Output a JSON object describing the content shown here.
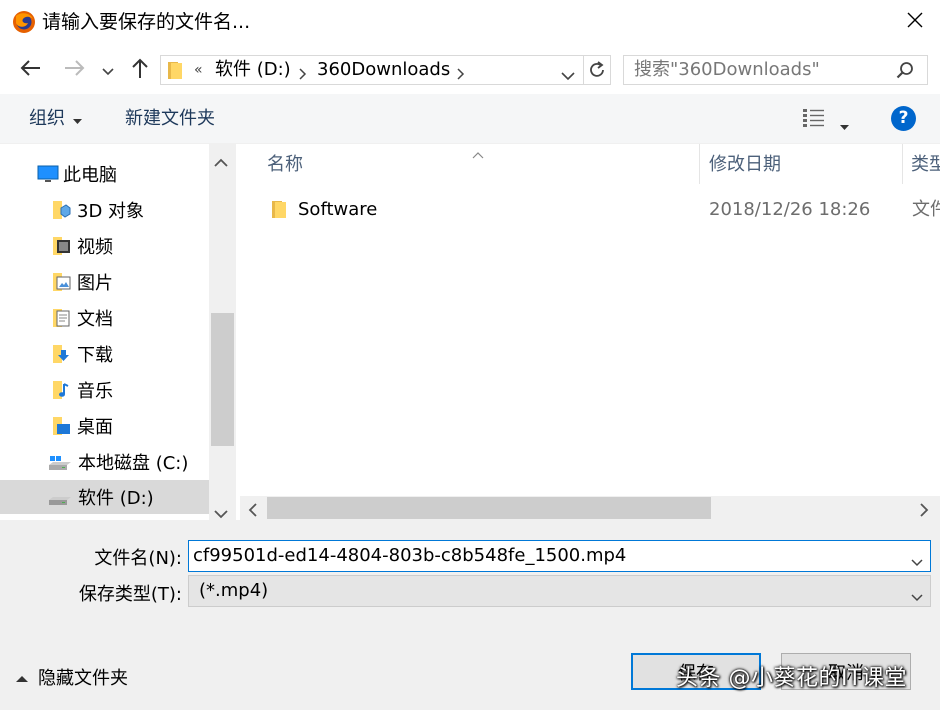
{
  "window": {
    "title": "请输入要保存的文件名...",
    "close_symbol": "✕"
  },
  "address": {
    "overflow": "«",
    "breadcrumbs": [
      "软件 (D:)",
      "360Downloads"
    ],
    "search_placeholder": "搜索\"360Downloads\""
  },
  "toolbar": {
    "organize_label": "组织",
    "new_folder_label": "新建文件夹",
    "help_label": "?"
  },
  "nav": {
    "items": [
      {
        "label": "此电脑",
        "icon": "this-pc-icon"
      },
      {
        "label": "3D 对象",
        "icon": "3d-objects-icon"
      },
      {
        "label": "视频",
        "icon": "videos-icon"
      },
      {
        "label": "图片",
        "icon": "pictures-icon"
      },
      {
        "label": "文档",
        "icon": "documents-icon"
      },
      {
        "label": "下载",
        "icon": "downloads-icon"
      },
      {
        "label": "音乐",
        "icon": "music-icon"
      },
      {
        "label": "桌面",
        "icon": "desktop-icon"
      },
      {
        "label": "本地磁盘 (C:)",
        "icon": "drive-icon"
      },
      {
        "label": "软件 (D:)",
        "icon": "drive-icon"
      }
    ],
    "selected": "软件 (D:)"
  },
  "file_list": {
    "columns": [
      "名称",
      "修改日期",
      "类型"
    ],
    "rows": [
      {
        "name": "Software",
        "modified": "2018/12/26 18:26",
        "type": "文件"
      }
    ]
  },
  "form": {
    "filename_label": "文件名(N):",
    "filename_value": "cf99501d-ed14-4804-803b-c8b548fe_1500.mp4",
    "filetype_label": "保存类型(T):",
    "filetype_value": "(*.mp4)",
    "hide_folders_label": "隐藏文件夹",
    "save_label": "保存",
    "cancel_label": "取消"
  },
  "watermark": "头条 @小葵花的IT课堂",
  "colors": {
    "accent": "#0078d7",
    "folder": "#ffd766",
    "selected_bg": "#d9d9d9"
  }
}
